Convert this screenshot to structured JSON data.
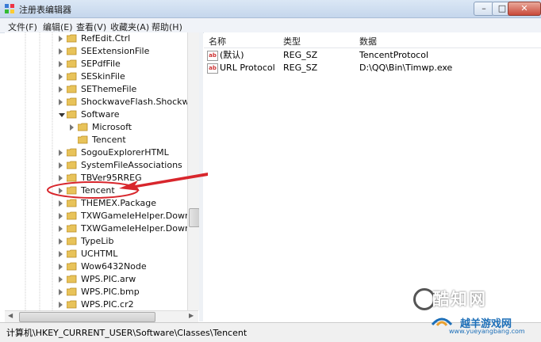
{
  "window": {
    "title": "注册表编辑器"
  },
  "menu": [
    "文件(F)",
    "编辑(E)",
    "查看(V)",
    "收藏夹(A)",
    "帮助(H)"
  ],
  "tree": [
    {
      "label": "RefEdit.Ctrl",
      "expanded": false,
      "indent": 0
    },
    {
      "label": "SEExtensionFile",
      "expanded": false,
      "indent": 0
    },
    {
      "label": "SEPdfFile",
      "expanded": false,
      "indent": 0
    },
    {
      "label": "SESkinFile",
      "expanded": false,
      "indent": 0
    },
    {
      "label": "SEThemeFile",
      "expanded": false,
      "indent": 0
    },
    {
      "label": "ShockwaveFlash.ShockwaveFl",
      "expanded": false,
      "indent": 0
    },
    {
      "label": "Software",
      "expanded": true,
      "indent": 0
    },
    {
      "label": "Microsoft",
      "expanded": false,
      "indent": 1
    },
    {
      "label": "Tencent",
      "expanded": false,
      "indent": 1,
      "noarrow": true
    },
    {
      "label": "SogouExplorerHTML",
      "expanded": false,
      "indent": 0
    },
    {
      "label": "SystemFileAssociations",
      "expanded": false,
      "indent": 0
    },
    {
      "label": "TBVer95RREG",
      "expanded": false,
      "indent": 0
    },
    {
      "label": "Tencent",
      "expanded": false,
      "indent": 0
    },
    {
      "label": "THEMEX.Package",
      "expanded": false,
      "indent": 0
    },
    {
      "label": "TXWGameIeHelper.Download",
      "expanded": false,
      "indent": 0
    },
    {
      "label": "TXWGameIeHelper.Download",
      "expanded": false,
      "indent": 0
    },
    {
      "label": "TypeLib",
      "expanded": false,
      "indent": 0
    },
    {
      "label": "UCHTML",
      "expanded": false,
      "indent": 0
    },
    {
      "label": "Wow6432Node",
      "expanded": false,
      "indent": 0
    },
    {
      "label": "WPS.PIC.arw",
      "expanded": false,
      "indent": 0
    },
    {
      "label": "WPS.PIC.bmp",
      "expanded": false,
      "indent": 0
    },
    {
      "label": "WPS.PIC.cr2",
      "expanded": false,
      "indent": 0
    }
  ],
  "columns": {
    "name": "名称",
    "type": "类型",
    "data": "数据"
  },
  "values": [
    {
      "name": "(默认)",
      "type": "REG_SZ",
      "data": "TencentProtocol"
    },
    {
      "name": "URL Protocol",
      "type": "REG_SZ",
      "data": "D:\\QQ\\Bin\\Timwp.exe"
    }
  ],
  "status": {
    "path": "计算机\\HKEY_CURRENT_USER\\Software\\Classes\\Tencent"
  },
  "watermark": {
    "brand": "酷知网",
    "site_cn": "越羊游戏网",
    "site_url": "www.yueyangbang.com"
  },
  "icons": {
    "folder": "folder-icon",
    "value": "string-value-icon",
    "app": "registry-editor-icon"
  },
  "colors": {
    "folder": "#e8c35a",
    "annotation": "#d8262c",
    "accent": "#1d6fb8"
  }
}
